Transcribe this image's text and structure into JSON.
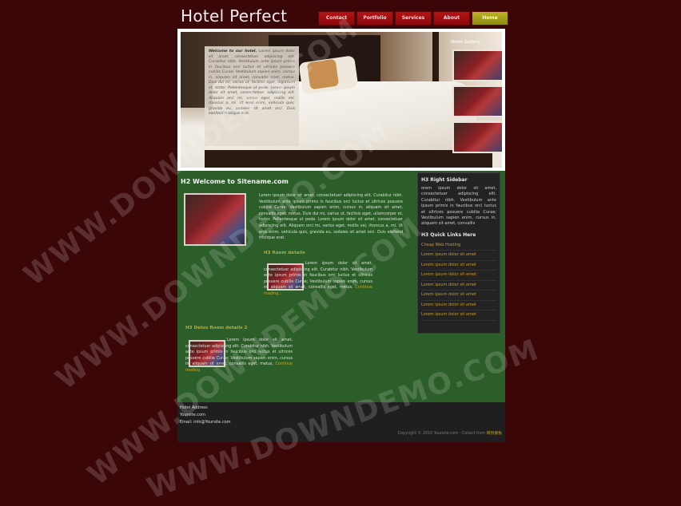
{
  "brand": {
    "title": "Hotel Perfect"
  },
  "nav": [
    {
      "label": "Contact"
    },
    {
      "label": "Portfolio"
    },
    {
      "label": "Services"
    },
    {
      "label": "About"
    },
    {
      "label": "Home"
    }
  ],
  "hero": {
    "welcome_bold": "Welcome to our hotel.",
    "welcome_text": "Lorem ipsum dolor sit amet, consectetuer adipiscing elit. Curabitur nibh. Vestibulum ante ipsum primis in faucibus orci luctus et ultrices posuere cubilia Curae; Vestibulum sapien enim, cursus in, aliquam sit amet, convallis eget, metus. Duis dui mi, varius ut, facilisis eget, dignissim et, tortor. Pellentesque ut pede. Lorem ipsum dolor sit amet, consectetuer adipiscing elit. Aliquam orci mi, varius eget, mollis vel, rhoncus a, mi. Ut eros enim, vehicula quis, gravida eu, sodales sit amet orci. Duis eleifend tristique erat.",
    "gallery_title": "Hotel Gallery"
  },
  "main": {
    "h2": "H2 Welcome to Sitename.com",
    "intro_text": "Lorem ipsum dolor sit amet, consectetuer adipiscing elit. Curabitur nibh. Vestibulum ante ipsum primis in faucibus orci luctus et ultrices posuere cubilia Curae; Vestibulum sapien enim, cursus in, aliquam sit amet, convallis eget, metus. Duis dui mi, varius ut, facilisis eget, ullamcorper et, tortor. Pellentesque ut pede. Lorem ipsum dolor sit amet, consectetuer adipiscing elit. Aliquam orci mi, varius eget, mollis vel, rhoncus a, mi. Ut eros enim, vehicula quis, gravida eu, sodales sit amet orci. Duis eleifend tristique erat.",
    "room_details_h3": "H3 Room details",
    "room_details_text": "Lorem ipsum dolor sit amet, consectetuer adipiscing elit. Curabitur nibh. Vestibulum ante ipsum primis in faucibus orci luctus et ultrices posuere cubilia Curae; Vestibulum sapien enim, cursus in, aliquam sit amet, convallis eget, metus.",
    "room_details_link": "Continue reading...",
    "deluxe_h3": "H3 Delux Room details 2",
    "deluxe_text": "Lorem ipsum dolor sit amet, consectetuer adipiscing elit. Curabitur nibh. Vestibulum ante ipsum primis in faucibus orci luctus et ultrices posuere cubilia Curae; Vestibulum sapien enim, cursus in, aliquam sit amet, convallis eget, metus.",
    "deluxe_link": "Continue reading"
  },
  "sidebar": {
    "h3": "H3 Right Sidebar",
    "text": "orem ipsum dolor sit amet, consectetuer adipiscing elit. Curabitur nibh. Vestibulum ante ipsum primis in faucibus orci luctus et ultrices posuere cubilia Curae; Vestibulum sapien enim, cursus in, aliquam sit amet, convallis",
    "links_h3": "H3 Quick Links Here",
    "links": [
      "Cheap Web Hosting",
      "Lorem ipsum dolor sit amet",
      "Lorem ipsum dolor sit amet",
      "Lorem ipsum dolor sit amet",
      "Lorem ipsum dolor sit amet",
      "Lorem ipsum dolor sit amet",
      "Lorem ipsum dolor sit amet",
      "Lorem ipsum dolor sit amet"
    ]
  },
  "footer": {
    "address_label": "Hotel Address",
    "site": "Yoursite.com",
    "email": "Email: info@Yoursite.com",
    "copyright": "Copyright © 2010 Yoursite.com - Collect from",
    "copyright_brand": "网页模板"
  },
  "watermark": "WWW.DOWNDEMO.COM"
}
